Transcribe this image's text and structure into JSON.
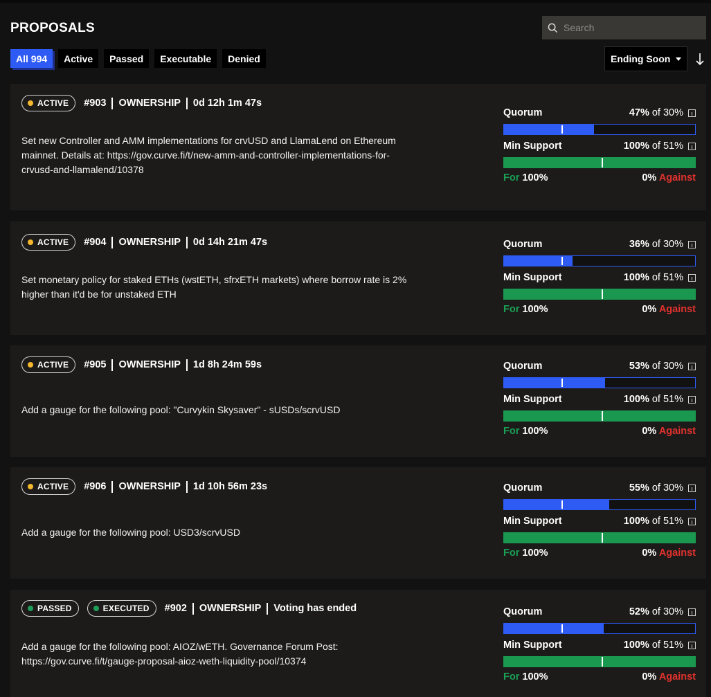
{
  "header": {
    "title": "PROPOSALS",
    "search_placeholder": "Search"
  },
  "filters": [
    {
      "label": "All 994",
      "selected": true
    },
    {
      "label": "Active",
      "selected": false
    },
    {
      "label": "Passed",
      "selected": false
    },
    {
      "label": "Executable",
      "selected": false
    },
    {
      "label": "Denied",
      "selected": false
    }
  ],
  "sort": {
    "label": "Ending Soon"
  },
  "colors": {
    "accent_blue": "#2f5bf5",
    "support_green": "#1a9850",
    "for_green": "#1aa155",
    "against_red": "#e0322d",
    "active_dot": "#f5b82e"
  },
  "labels": {
    "quorum": "Quorum",
    "min_support": "Min Support",
    "for": "For",
    "against": "Against"
  },
  "proposals": [
    {
      "badges": [
        "ACTIVE"
      ],
      "id": "#903",
      "type": "OWNERSHIP",
      "time": "0d 12h 1m 47s",
      "description": "Set new Controller and AMM implementations for crvUSD and LlamaLend on Ethereum mainnet. Details at: https://gov.curve.fi/t/new-amm-and-controller-implementations-for-crvusd-and-llamalend/10378",
      "quorum_pct": "47%",
      "quorum_req": "of 30%",
      "quorum_value": 47,
      "quorum_threshold": 30,
      "support_pct": "100%",
      "support_req": "of 51%",
      "support_value": 100,
      "support_threshold": 51,
      "for_pct": "100%",
      "against_pct": "0%"
    },
    {
      "badges": [
        "ACTIVE"
      ],
      "id": "#904",
      "type": "OWNERSHIP",
      "time": "0d 14h 21m 47s",
      "description": "Set monetary policy for staked ETHs (wstETH, sfrxETH markets) where borrow rate is 2% higher than it'd be for unstaked ETH",
      "quorum_pct": "36%",
      "quorum_req": "of 30%",
      "quorum_value": 36,
      "quorum_threshold": 30,
      "support_pct": "100%",
      "support_req": "of 51%",
      "support_value": 100,
      "support_threshold": 51,
      "for_pct": "100%",
      "against_pct": "0%"
    },
    {
      "badges": [
        "ACTIVE"
      ],
      "id": "#905",
      "type": "OWNERSHIP",
      "time": "1d 8h 24m 59s",
      "description": "Add a gauge for the following pool: \"Curvykin Skysaver\" - sUSDs/scrvUSD",
      "quorum_pct": "53%",
      "quorum_req": "of 30%",
      "quorum_value": 53,
      "quorum_threshold": 30,
      "support_pct": "100%",
      "support_req": "of 51%",
      "support_value": 100,
      "support_threshold": 51,
      "for_pct": "100%",
      "against_pct": "0%"
    },
    {
      "badges": [
        "ACTIVE"
      ],
      "id": "#906",
      "type": "OWNERSHIP",
      "time": "1d 10h 56m 23s",
      "description": "Add a gauge for the following pool: USD3/scrvUSD",
      "quorum_pct": "55%",
      "quorum_req": "of 30%",
      "quorum_value": 55,
      "quorum_threshold": 30,
      "support_pct": "100%",
      "support_req": "of 51%",
      "support_value": 100,
      "support_threshold": 51,
      "for_pct": "100%",
      "against_pct": "0%"
    },
    {
      "badges": [
        "PASSED",
        "EXECUTED"
      ],
      "id": "#902",
      "type": "OWNERSHIP",
      "time": "Voting has ended",
      "description": "Add a gauge for the following pool: AIOZ/wETH. Governance Forum Post: https://gov.curve.fi/t/gauge-proposal-aioz-weth-liquidity-pool/10374",
      "quorum_pct": "52%",
      "quorum_req": "of 30%",
      "quorum_value": 52,
      "quorum_threshold": 30,
      "support_pct": "100%",
      "support_req": "of 51%",
      "support_value": 100,
      "support_threshold": 51,
      "for_pct": "100%",
      "against_pct": "0%"
    }
  ]
}
